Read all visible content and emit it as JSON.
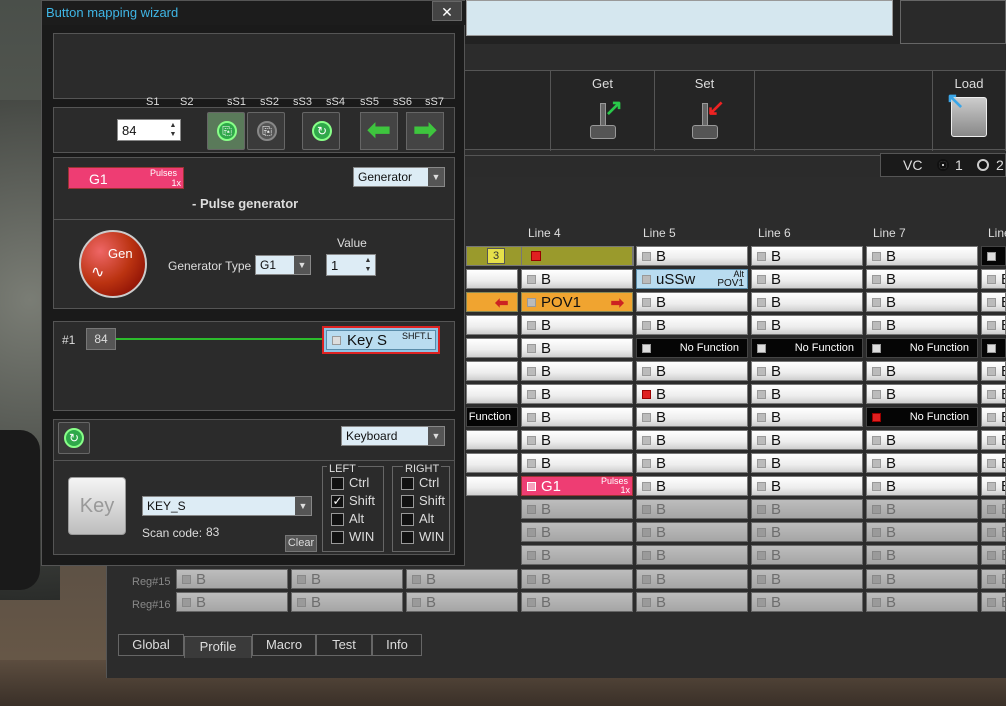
{
  "wizard": {
    "title": "Button mapping wizard",
    "close": "✕",
    "leds": [
      "S1",
      "S2",
      "sS1",
      "sS2",
      "sS3",
      "sS4",
      "sS5",
      "sS6",
      "sS7"
    ],
    "button_number": "84",
    "generator": {
      "label": "G1",
      "pulses": "Pulses",
      "pulses_count": "1x",
      "category": "Generator",
      "heading": "- Pulse generator",
      "icon_text": "Gen",
      "type_label": "Generator Type",
      "type_value": "G1",
      "value_label": "Value",
      "value": "1"
    },
    "chain": {
      "index": "#1",
      "button": "84",
      "key_label": "Key S",
      "key_mod": "SHFT.L"
    },
    "output": {
      "category": "Keyboard",
      "key_icon": "Key",
      "key_value": "KEY_S",
      "scan_label": "Scan code:",
      "scan_value": "83",
      "clear": "Clear",
      "left_header": "LEFT",
      "right_header": "RIGHT",
      "mods": [
        "Ctrl",
        "Shift",
        "Alt",
        "WIN"
      ],
      "left_checked": [
        false,
        true,
        false,
        false
      ],
      "right_checked": [
        false,
        false,
        false,
        false
      ]
    }
  },
  "toolbar": {
    "get": "Get",
    "set": "Set",
    "load": "Load",
    "vc_label": "VC",
    "vc1": "1",
    "vc2": "2"
  },
  "lines": {
    "headers": [
      "Line 4",
      "Line 5",
      "Line 6",
      "Line 7",
      "Line"
    ],
    "badge": "3",
    "left_function": "Function",
    "no_function": "No Function",
    "b": "B",
    "pov": "POV1",
    "ussw": "uSSw",
    "alt": "Alt",
    "pov_small": "POV1",
    "g1": "G1",
    "pulses": "Pulses",
    "pulses_count": "1x"
  },
  "regs": [
    "Reg#15",
    "Reg#16"
  ],
  "tabs": [
    "Global",
    "Profile",
    "Macro",
    "Test",
    "Info"
  ],
  "active_tab": "Profile"
}
